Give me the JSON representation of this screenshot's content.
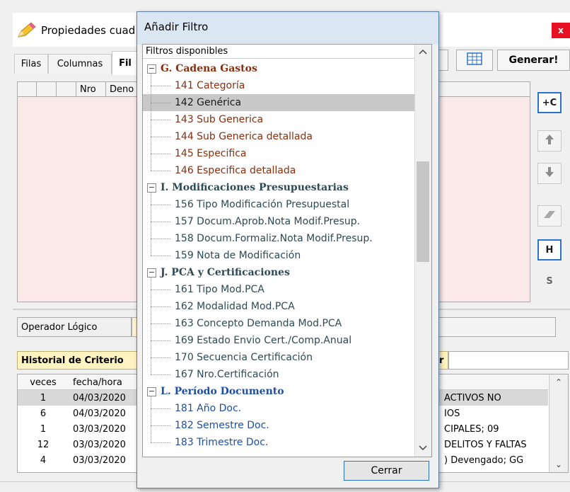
{
  "background_window": {
    "title": "Propiedades cuad",
    "close_label": "x",
    "tabs": [
      "Filas",
      "Columnas",
      "Fil"
    ],
    "generar_label": "Generar!",
    "grid_columns": [
      "Nro",
      "Deno"
    ],
    "side_buttons": {
      "add_c": "+C",
      "h": "H",
      "s": "S"
    },
    "operador_label": "Operador Lógico",
    "historial_label": "Historial de Criterio",
    "historial_right_fragment": "r",
    "table_headers": [
      "veces",
      "fecha/hora"
    ],
    "table_rows": [
      {
        "veces": "1",
        "fecha": "04/03/2020",
        "right": "ACTIVOS NO"
      },
      {
        "veces": "6",
        "fecha": "04/03/2020",
        "right": "IOS"
      },
      {
        "veces": "1",
        "fecha": "03/03/2020",
        "right": "CIPALES; 09"
      },
      {
        "veces": "12",
        "fecha": "03/03/2020",
        "right": "DELITOS Y FALTAS"
      },
      {
        "veces": "4",
        "fecha": "03/03/2020",
        "right": ") Devengado; GG"
      }
    ]
  },
  "dialog": {
    "title": "Añadir Filtro",
    "list_header": "Filtros disponibles",
    "close_button": "Cerrar",
    "tree": [
      {
        "kind": "group",
        "label": "G. Cadena Gastos",
        "color": "#8b2e0e"
      },
      {
        "kind": "item",
        "label": "141 Categoría",
        "color": "#8b2e0e"
      },
      {
        "kind": "item",
        "label": "142 Genérica",
        "color": "#1a1a1a",
        "selected": true
      },
      {
        "kind": "item",
        "label": "143 Sub Generica",
        "color": "#8b2e0e"
      },
      {
        "kind": "item",
        "label": "144 Sub Generica detallada",
        "color": "#8b2e0e"
      },
      {
        "kind": "item",
        "label": "145 Especifica",
        "color": "#8b2e0e"
      },
      {
        "kind": "item",
        "label": "146 Especifica detallada",
        "color": "#8b2e0e"
      },
      {
        "kind": "group",
        "label": "I. Modificaciones Presupuestarias",
        "color": "#2d4a55"
      },
      {
        "kind": "item",
        "label": "156 Tipo Modificación Presupuestal",
        "color": "#2d4a55"
      },
      {
        "kind": "item",
        "label": "157 Docum.Aprob.Nota Modif.Presup.",
        "color": "#2d4a55"
      },
      {
        "kind": "item",
        "label": "158 Docum.Formaliz.Nota Modif.Presup.",
        "color": "#2d4a55"
      },
      {
        "kind": "item",
        "label": "159 Nota de Modificación",
        "color": "#2d4a55"
      },
      {
        "kind": "group",
        "label": "J. PCA y Certificaciones",
        "color": "#2d4a55"
      },
      {
        "kind": "item",
        "label": "161 Tipo Mod.PCA",
        "color": "#2d4a55"
      },
      {
        "kind": "item",
        "label": "162 Modalidad Mod.PCA",
        "color": "#2d4a55"
      },
      {
        "kind": "item",
        "label": "163 Concepto Demanda Mod.PCA",
        "color": "#2d4a55"
      },
      {
        "kind": "item",
        "label": "169 Estado Envio Cert./Comp.Anual",
        "color": "#2d4a55"
      },
      {
        "kind": "item",
        "label": "170 Secuencia Certificación",
        "color": "#2d4a55"
      },
      {
        "kind": "item",
        "label": "167 Nro.Certificación",
        "color": "#2d4a55"
      },
      {
        "kind": "group",
        "label": "L. Período Documento",
        "color": "#1f4fa0"
      },
      {
        "kind": "item",
        "label": "181 Año Doc.",
        "color": "#1f4fa0"
      },
      {
        "kind": "item",
        "label": "182 Semestre Doc.",
        "color": "#1f4fa0"
      },
      {
        "kind": "item",
        "label": "183 Trimestre Doc.",
        "color": "#1f4fa0"
      }
    ]
  },
  "colors": {
    "selection": "#c8c8c8",
    "accent_border": "#2b72c8",
    "close_red": "#e81123"
  }
}
